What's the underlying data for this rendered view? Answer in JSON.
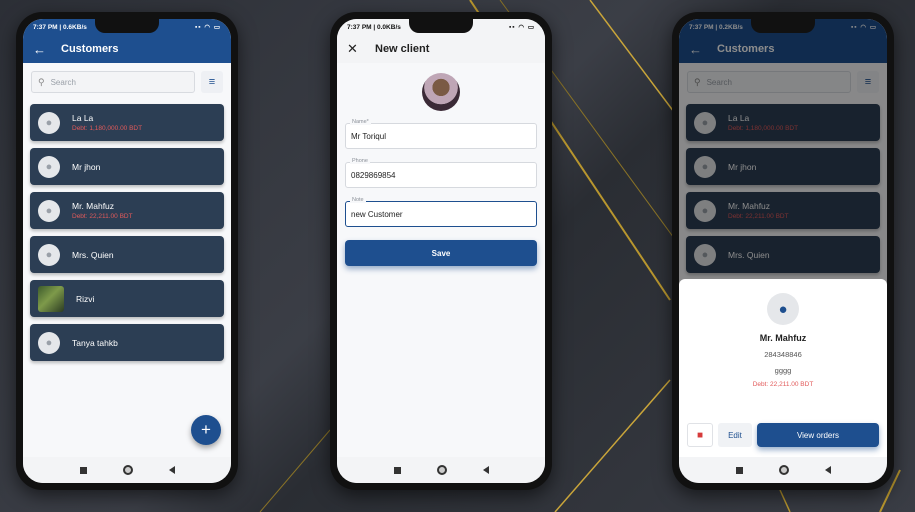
{
  "status": {
    "time": "7:37 PM",
    "speed1": "0.6KB/s",
    "speed2": "0.0KB/s",
    "speed3": "0.2KB/s",
    "battery": "80"
  },
  "customers": {
    "title": "Customers",
    "search_placeholder": "Search",
    "items": [
      {
        "name": "La La",
        "debt": "Debt: 1,180,000.00 BDT"
      },
      {
        "name": "Mr jhon",
        "debt": ""
      },
      {
        "name": "Mr. Mahfuz",
        "debt": "Debt: 22,211.00 BDT"
      },
      {
        "name": "Mrs. Quien",
        "debt": ""
      },
      {
        "name": "Rizvi",
        "debt": ""
      },
      {
        "name": "Tanya tahkb",
        "debt": ""
      }
    ],
    "fab": "+"
  },
  "new_client": {
    "title": "New client",
    "fields": [
      {
        "label": "Name*",
        "value": "Mr Toriqul"
      },
      {
        "label": "Phone",
        "value": "0829869854"
      },
      {
        "label": "Note",
        "value": "new Customer"
      }
    ],
    "save_label": "Save"
  },
  "detail": {
    "name": "Mr. Mahfuz",
    "phone": "284348846",
    "note": "gggg",
    "debt": "Debt: 22,211.00 BDT",
    "edit_label": "Edit",
    "orders_label": "View orders"
  },
  "icons": {
    "back": "arrow-left-icon",
    "close": "close-icon",
    "search": "search-icon",
    "filter": "filter-icon",
    "person": "person-icon",
    "delete": "trash-icon"
  },
  "colors": {
    "primary": "#1e4f8f",
    "card": "#2c3e54",
    "debt": "#e25a5a"
  }
}
